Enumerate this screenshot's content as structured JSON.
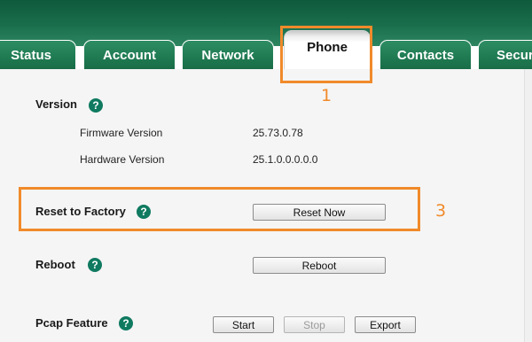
{
  "tabs": [
    {
      "label": "Status",
      "active": false
    },
    {
      "label": "Account",
      "active": false
    },
    {
      "label": "Network",
      "active": false
    },
    {
      "label": "Phone",
      "active": true
    },
    {
      "label": "Contacts",
      "active": false
    },
    {
      "label": "Security",
      "active": false
    }
  ],
  "version": {
    "title": "Version",
    "firmware_label": "Firmware Version",
    "firmware_value": "25.73.0.78",
    "hardware_label": "Hardware Version",
    "hardware_value": "25.1.0.0.0.0.0"
  },
  "reset": {
    "title": "Reset to Factory",
    "button": "Reset Now"
  },
  "reboot": {
    "title": "Reboot",
    "button": "Reboot"
  },
  "pcap": {
    "title": "Pcap Feature",
    "start": "Start",
    "stop": "Stop",
    "export": "Export"
  },
  "help_glyph": "?",
  "annotations": [
    {
      "number": "1",
      "target": "Phone tab"
    },
    {
      "number": "3",
      "target": "Reset to Factory row"
    }
  ],
  "colors": {
    "header": "#1a6e4c",
    "tab": "#1f7a52",
    "help": "#0f7a60",
    "highlight": "#f08a2a"
  }
}
